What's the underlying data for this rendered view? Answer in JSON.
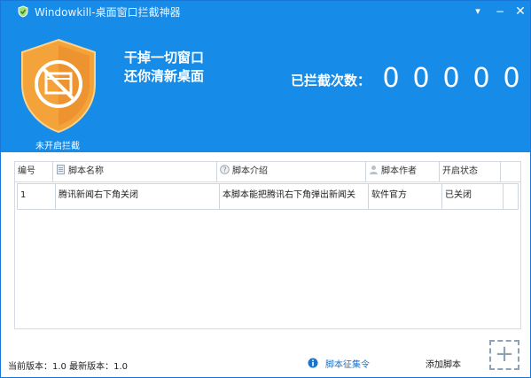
{
  "app": {
    "title": "Windowkill-桌面窗口拦截神器",
    "buttons": {
      "menu": "▾",
      "minimize": "−",
      "close": "✕"
    }
  },
  "header": {
    "slogan_line1": "干掉一切窗口",
    "slogan_line2": "还你清新桌面",
    "counter_label": "已拦截次数：",
    "counter_digits": [
      "0",
      "0",
      "0",
      "0",
      "0"
    ],
    "shield_status": "未开启拦截"
  },
  "table": {
    "columns": [
      "编号",
      "脚本名称",
      "脚本介绍",
      "脚本作者",
      "开启状态"
    ],
    "rows": [
      {
        "id": "1",
        "name": "腾讯新闻右下角关闭",
        "desc": "本脚本能把腾讯右下角弹出新闻关",
        "author": "软件官方",
        "status": "已关闭"
      }
    ]
  },
  "footer": {
    "version": "当前版本：1.0 最新版本：1.0",
    "script_order": "脚本征集令",
    "add_label": "添加脚本",
    "add_button": "+"
  },
  "colors": {
    "header_bg": "#178be8",
    "shield_orange": "#f39b2e",
    "link_blue": "#1a73cc"
  }
}
